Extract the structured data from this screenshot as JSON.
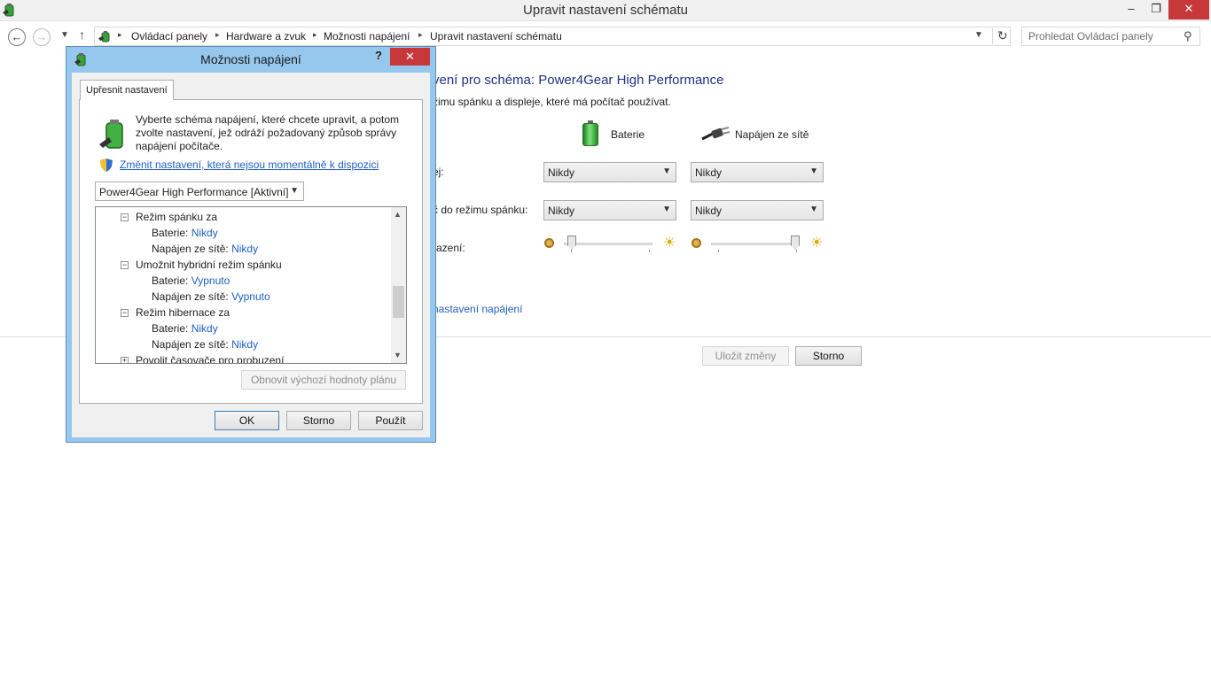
{
  "window": {
    "title": "Upravit nastavení schématu",
    "controls": {
      "minimize": "–",
      "maximize": "❐",
      "close": "✕"
    }
  },
  "address_bar": {
    "breadcrumbs": [
      "Ovládací panely",
      "Hardware a zvuk",
      "Možnosti napájení",
      "Upravit nastavení schématu"
    ],
    "separator": "▸",
    "search_placeholder": "Prohledat Ovládací panely"
  },
  "main": {
    "title": "vení pro schéma: Power4Gear High Performance",
    "subtitle": "žimu spánku a displeje, které má počítač používat.",
    "columns": {
      "battery": "Baterie",
      "plugged": "Napájen ze sítě"
    },
    "rows": [
      {
        "label": "ej:",
        "battery": "Nikdy",
        "plugged": "Nikdy"
      },
      {
        "label": "č do režimu spánku:",
        "battery": "Nikdy",
        "plugged": "Nikdy"
      }
    ],
    "brightness": {
      "label": "razení:",
      "battery_level": 0.0,
      "plugged_level": 1.0
    },
    "advanced_link": "nastavení napájení",
    "save_label": "Uložit změny",
    "cancel_label": "Storno"
  },
  "dialog": {
    "title": "Možnosti napájení",
    "help": "?",
    "tab_label": "Upřesnit nastavení",
    "intro_text": "Vyberte schéma napájení, které chcete upravit, a potom zvolte nastavení, jež odráží požadovaný způsob správy napájení počítače.",
    "change_link": "Změnit nastavení, která nejsou momentálně k dispozici",
    "scheme_value": "Power4Gear High Performance [Aktivní]",
    "tree": [
      {
        "label": "Režim spánku za",
        "kind": "group",
        "expand": "−"
      },
      {
        "label": "Baterie:",
        "value": "Nikdy",
        "kind": "item"
      },
      {
        "label": "Napájen ze sítě:",
        "value": "Nikdy",
        "kind": "item"
      },
      {
        "label": "Umožnit hybridní režim spánku",
        "kind": "group",
        "expand": "−"
      },
      {
        "label": "Baterie:",
        "value": "Vypnuto",
        "kind": "item"
      },
      {
        "label": "Napájen ze sítě:",
        "value": "Vypnuto",
        "kind": "item"
      },
      {
        "label": "Režim hibernace za",
        "kind": "group",
        "expand": "−"
      },
      {
        "label": "Baterie:",
        "value": "Nikdy",
        "kind": "item"
      },
      {
        "label": "Napájen ze sítě:",
        "value": "Nikdy",
        "kind": "item"
      },
      {
        "label": "Povolit časovače pro probuzení",
        "kind": "group",
        "expand": "+"
      }
    ],
    "restore_label": "Obnovit výchozí hodnoty plánu",
    "ok_label": "OK",
    "cancel_label": "Storno",
    "apply_label": "Použít"
  },
  "colors": {
    "accent_link": "#1f5fbf",
    "title_blue": "#1e3287",
    "dialog_frame": "#96c8ee",
    "close_red": "#c7383a"
  }
}
